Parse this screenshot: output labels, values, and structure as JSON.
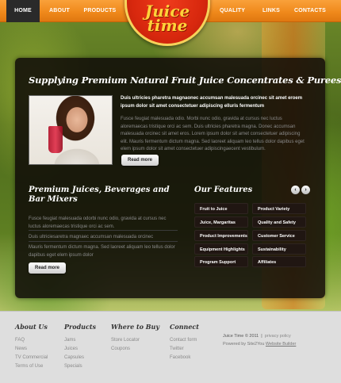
{
  "nav": {
    "home": "HOME",
    "about": "ABOUT",
    "products": "PRODUCTS",
    "quality": "QUALITY",
    "links": "LINKS",
    "contacts": "CONTACTS"
  },
  "logo": {
    "line1": "Juice",
    "line2": "time"
  },
  "hero": {
    "headline": "Supplying Premium Natural Fruit Juice Concentrates & Purees",
    "intro_bold": "Duis ultricies pharetra magnaonec accumsan malesuada orcinec sit amet eroem ipsum dolor sit amet consectetuer adipiscing elluris fermentum",
    "intro_text": "Fusce feugiat malesuada odio. Morbi nunc odio, gravida at cursus nec luctus aloremaecas tristique orci ac sem. Duis ultricies pharetra magna. Donec accumsan malesuada orcinec sit amet eros. Lorem ipsum dolor sit amet consectetuer adipiscing elit. Mauris fermentum dictum magna. Sed laoreet aliquam leo tellus dolor dapibus eget elem ipsum dolor sit amet consectetuer adipiscingaecent vestibulum.",
    "read_more": "Read more"
  },
  "premium": {
    "title": "Premium Juices, Beverages and Bar Mixers",
    "text1": "Fusce feugiat malesuada odorbi nunc odio, gravida at cursus nec luctus aloremaecas tristique orci ac sem.",
    "text2": "Duis ultriciesaretra magnaec accumsan malesuada orcinec",
    "text3": "Mauris fermentum dictum magna. Sed laoreet aliquam leo tellus dolor dapibus eget elem ipsum dolor",
    "read_more": "Read more"
  },
  "features": {
    "title": "Our Features",
    "prev": "‹",
    "next": "›",
    "items": [
      "Fruit to Juice",
      "Product Variety",
      "Juice, Margaritas",
      "Quality and Safety",
      "Product Improvements",
      "Customer Service",
      "Equipment Highlights",
      "Sustainability",
      "Program Support",
      "Affiliates"
    ]
  },
  "footer": {
    "about": {
      "title": "About Us",
      "links": [
        "FAQ",
        "News",
        "TV Commercial",
        "Terms of Use"
      ]
    },
    "products": {
      "title": "Products",
      "links": [
        "Jams",
        "Juices",
        "Capsules",
        "Specials"
      ]
    },
    "where": {
      "title": "Where to Buy",
      "links": [
        "Store Locator",
        "Coupons"
      ]
    },
    "connect": {
      "title": "Connect",
      "links": [
        "Contact form",
        "Twitter",
        "Facebook"
      ]
    },
    "copyright": "Juice Time © 2011",
    "privacy": "privacy policy",
    "powered": "Powered by Site2You",
    "builder": "Website Builder"
  },
  "colors": {
    "nav_orange": "#f08a1c",
    "logo_red": "#d8280e",
    "logo_yellow": "#ffd23a",
    "panel_dark": "#0f0a08"
  }
}
